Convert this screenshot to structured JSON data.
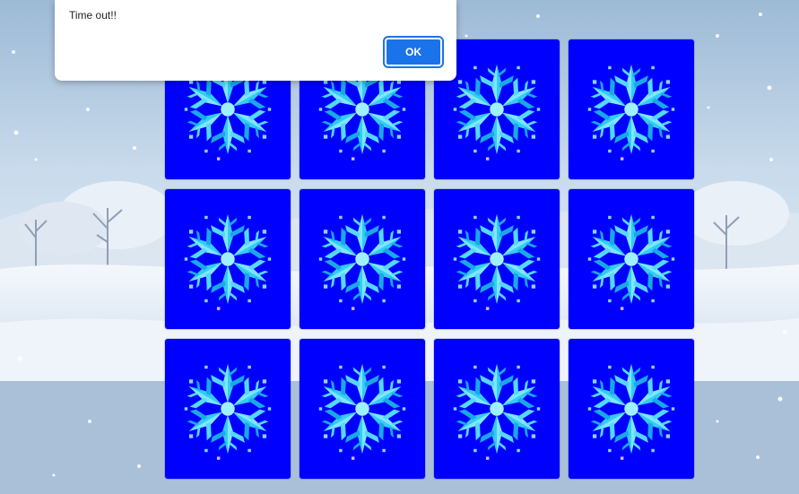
{
  "dialog": {
    "message": "Time out!!",
    "ok_label": "OK"
  },
  "board": {
    "rows": 3,
    "columns": 4,
    "card_face": "snowflake-icon",
    "card_color": "#0000ff"
  },
  "colors": {
    "card_back": "#0000ff",
    "snowflake_light": "#7fe6ff",
    "snowflake_mid": "#33ccf5",
    "snowflake_dark": "#1aa8e6",
    "ok_button": "#1a73e8"
  }
}
